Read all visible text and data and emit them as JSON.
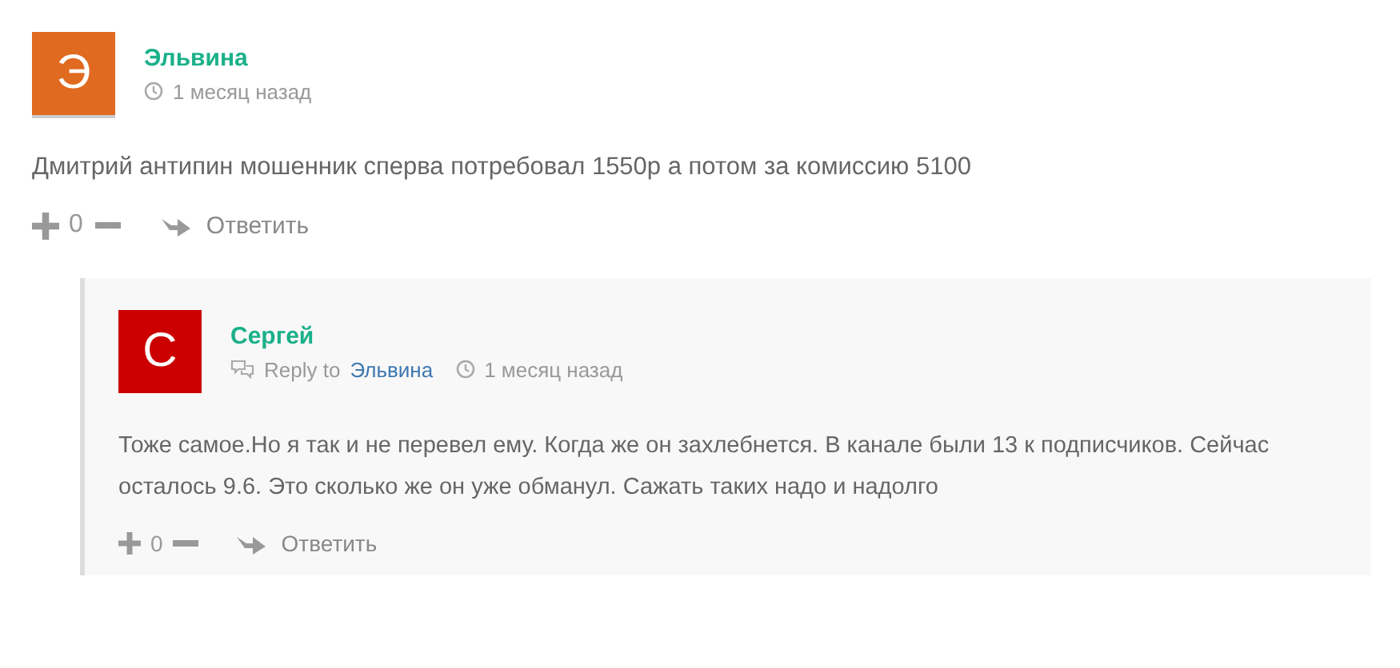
{
  "comments": [
    {
      "avatar": {
        "letter": "Э",
        "color": "#e06a1f"
      },
      "author": "Эльвина",
      "time": "1 месяц назад",
      "text": "Дмитрий антипин мошенник сперва потребовал 1550р а потом за комиссию 5100",
      "votes": "0",
      "reply_label": "Ответить",
      "children": [
        {
          "avatar": {
            "letter": "С",
            "color": "#cc0000"
          },
          "author": "Сергей",
          "reply_to": {
            "label": "Reply to",
            "name": "Эльвина"
          },
          "time": "1 месяц назад",
          "text": "Тоже самое.Но я так и не перевел ему. Когда же он захлебнется. В канале были 13 к подписчиков. Сейчас осталось 9.6. Это сколько же он уже обманул. Сажать таких надо и надолго",
          "votes": "0",
          "reply_label": "Ответить"
        }
      ]
    }
  ]
}
